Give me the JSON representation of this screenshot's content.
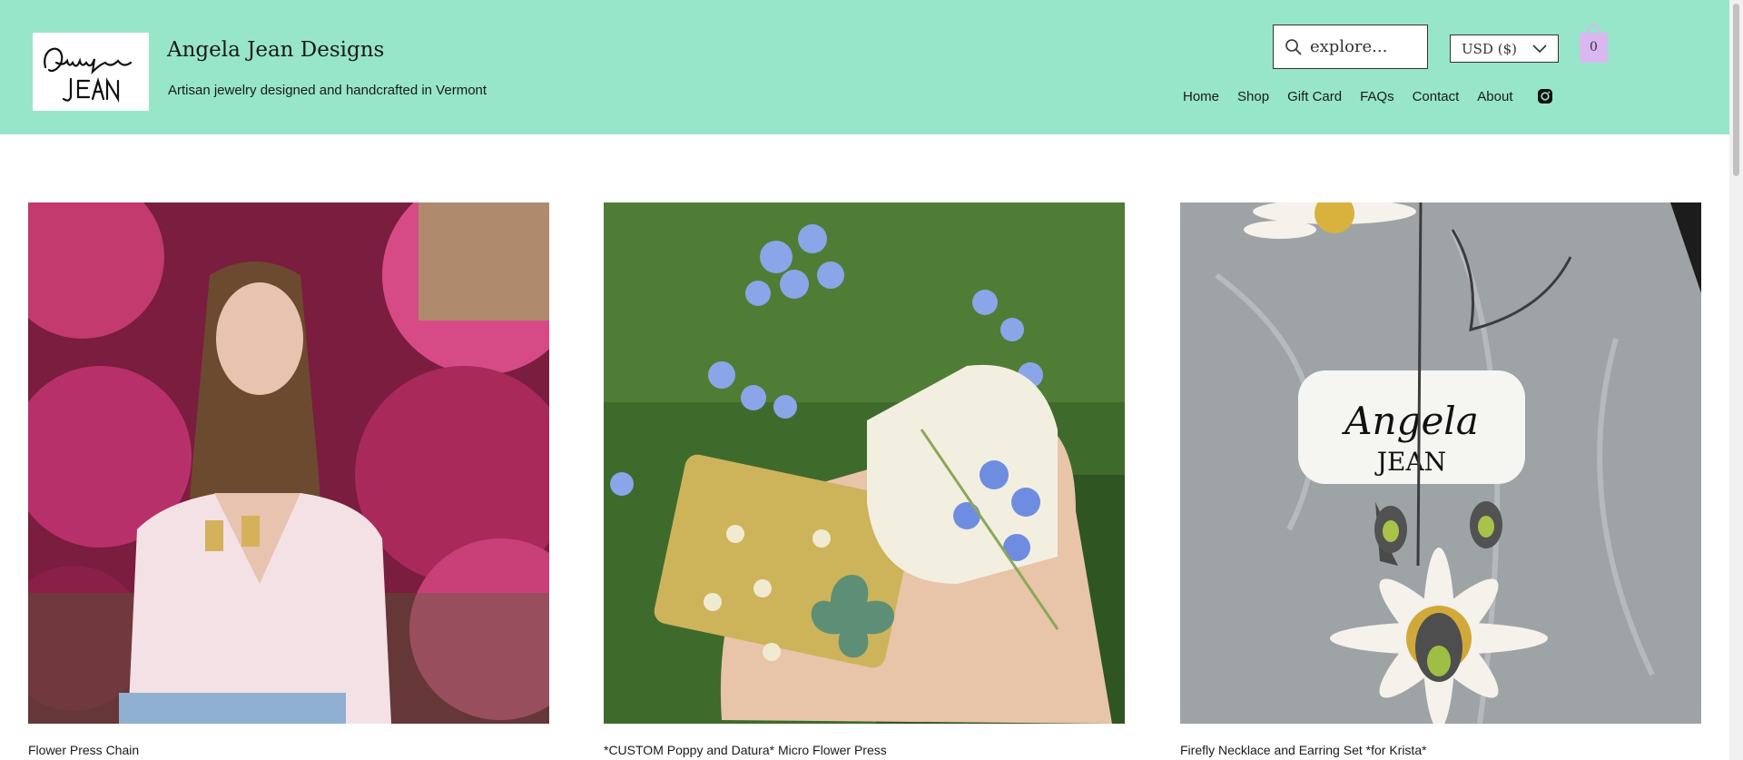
{
  "brand": {
    "title": "Angela Jean Designs",
    "tagline": "Artisan jewelry designed and handcrafted in Vermont",
    "logo_text_top": "Angela",
    "logo_text_bottom": "JEAN"
  },
  "search": {
    "placeholder": "explore..."
  },
  "currency": {
    "selected": "USD ($)"
  },
  "cart": {
    "count": "0"
  },
  "nav": {
    "items": [
      "Home",
      "Shop",
      "Gift Card",
      "FAQs",
      "Contact",
      "About"
    ]
  },
  "icons": {
    "search": "search-icon",
    "dropdown": "chevron-down-icon",
    "cart": "shopping-bag-icon",
    "social": "instagram-icon"
  },
  "colors": {
    "header_bg": "#97e6c9",
    "cart_bg": "#d9b8ef"
  },
  "products": [
    {
      "name": "Flower Press Chain"
    },
    {
      "name": "*CUSTOM Poppy and Datura* Micro Flower Press"
    },
    {
      "name": "Firefly Necklace and Earring Set *for Krista*"
    }
  ]
}
